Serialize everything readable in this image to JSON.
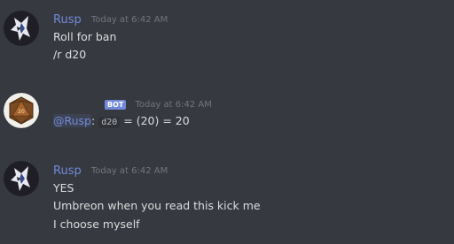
{
  "messages": [
    {
      "author": "Rusp",
      "timestamp": "Today at 6:42 AM",
      "lines": [
        "Roll for ban",
        "/r d20"
      ]
    },
    {
      "author": "",
      "bot_tag": "BOT",
      "timestamp": "Today at 6:42 AM",
      "mention": "@Rusp",
      "separator": ":",
      "code": "d20",
      "result": "= (20) = 20"
    },
    {
      "author": "Rusp",
      "timestamp": "Today at 6:42 AM",
      "lines": [
        "YES",
        "Umbreon when you read this kick me",
        "I choose myself"
      ]
    }
  ],
  "colors": {
    "background": "#36393f",
    "username": "#7289da",
    "timestamp": "#72767d",
    "text": "#dcddde",
    "bot_tag": "#7289da"
  }
}
